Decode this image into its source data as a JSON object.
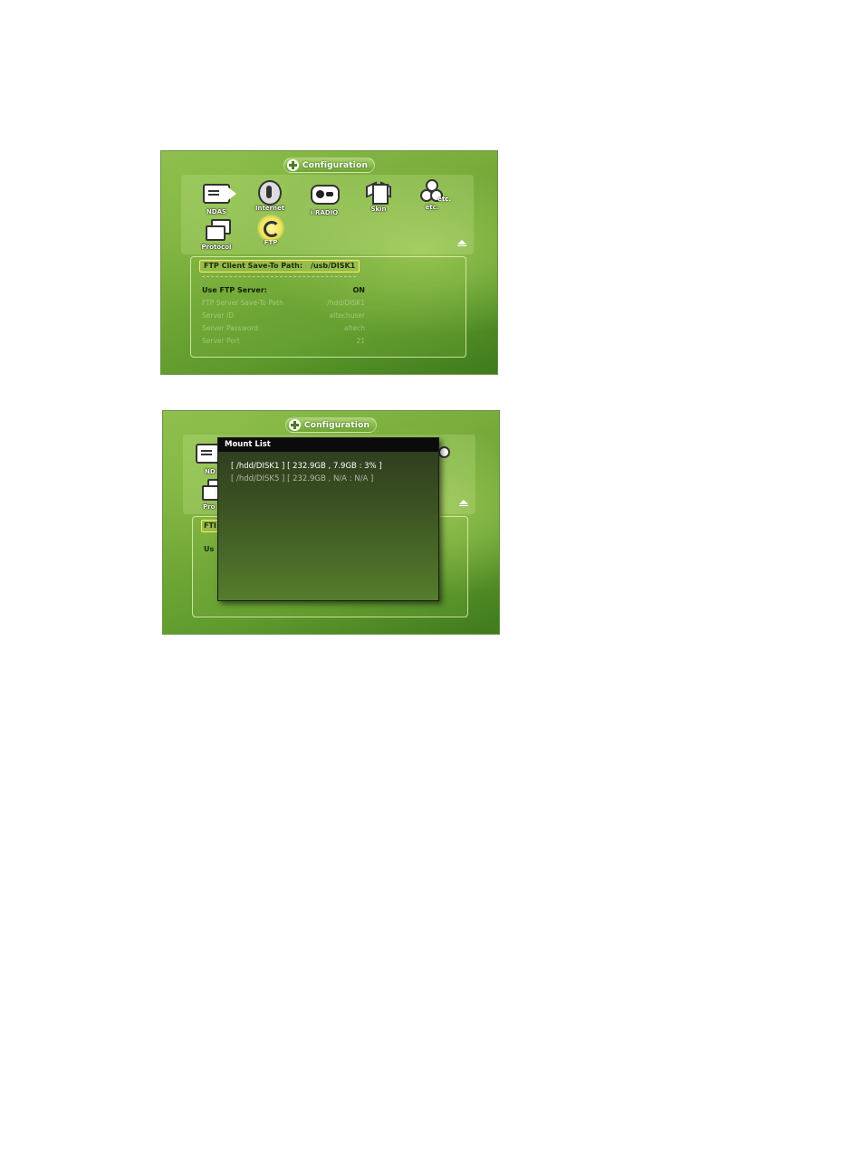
{
  "screens": [
    {
      "title": "Configuration",
      "menu": [
        {
          "label": "NDAS",
          "icon": "ndas-icon"
        },
        {
          "label": "Internet",
          "icon": "internet-icon"
        },
        {
          "label": "i-RADIO",
          "icon": "radio-icon"
        },
        {
          "label": "Skin",
          "icon": "shirt-icon"
        },
        {
          "label": "etc.",
          "icon": "etc-icon",
          "badge": "etc."
        },
        {
          "label": "Protocol",
          "icon": "protocol-icon"
        },
        {
          "label": "FTP",
          "icon": "ftp-icon",
          "selected": true
        }
      ],
      "client_path": {
        "label": "FTP Client Save-To Path:",
        "value": "/usb/DISK1"
      },
      "settings": [
        {
          "label": "Use FTP Server:",
          "value": "ON",
          "active": true
        },
        {
          "label": "FTP Server Save-To Path",
          "value": "/hdd/DISK1",
          "active": false
        },
        {
          "label": "Server ID",
          "value": "altechuser",
          "active": false
        },
        {
          "label": "Server Password",
          "value": "altech",
          "active": false
        },
        {
          "label": "Server Port",
          "value": "21",
          "active": false
        }
      ]
    },
    {
      "title": "Configuration",
      "dialog": {
        "title": "Mount List",
        "rows": [
          {
            "text": "[ /hdd/DISK1 ] [ 232.9GB , 7.9GB :   3% ]",
            "active": true
          },
          {
            "text": "[ /hdd/DISK5 ] [ 232.9GB , N/A  : N/A  ]",
            "active": false
          }
        ]
      },
      "ghost": {
        "ndas": "ND",
        "protocol": "Pro",
        "client": "FTI",
        "use": "Us"
      }
    }
  ]
}
